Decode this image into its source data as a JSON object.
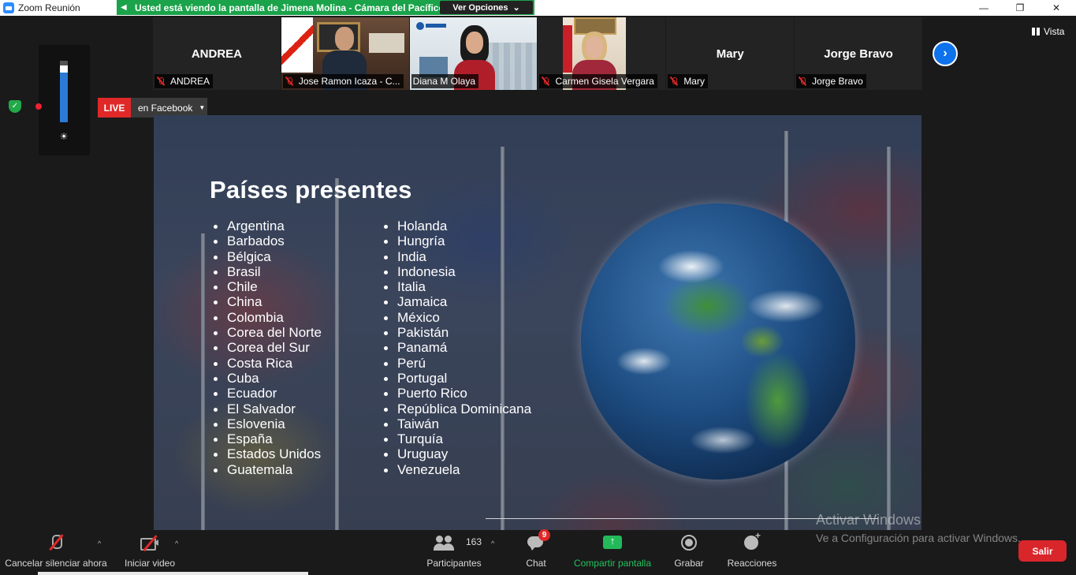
{
  "window": {
    "title": "Zoom Reunión",
    "minimize": "—",
    "restore": "❐",
    "close": "✕"
  },
  "share_banner": {
    "message": "Usted está viendo la pantalla de Jimena Molina - Cámara del Pacífico",
    "options_label": "Ver Opciones",
    "options_caret": "⌄"
  },
  "view": {
    "label": "Vista"
  },
  "participants": [
    {
      "display_name": "ANDREA",
      "tag": "ANDREA",
      "video": false,
      "muted": true
    },
    {
      "display_name": "",
      "tag": "Jose Ramon Icaza - C...",
      "video": true,
      "muted": true
    },
    {
      "display_name": "",
      "tag": "Diana M Olaya",
      "video": true,
      "muted": false,
      "active_speaker": true
    },
    {
      "display_name": "",
      "tag": "Carmen Gisela Vergara",
      "video": true,
      "muted": true
    },
    {
      "display_name": "Mary",
      "tag": "Mary",
      "video": false,
      "muted": true
    },
    {
      "display_name": "Jorge Bravo",
      "tag": "Jorge Bravo",
      "video": false,
      "muted": true
    }
  ],
  "live": {
    "badge": "LIVE",
    "destination": "en Facebook",
    "caret": "▼"
  },
  "slide": {
    "title": "Países presentes",
    "column1": [
      "Argentina",
      "Barbados",
      "Bélgica",
      "Brasil",
      "Chile",
      "China",
      "Colombia",
      "Corea del Norte",
      "Corea del Sur",
      "Costa Rica",
      "Cuba",
      "Ecuador",
      "El Salvador",
      "Eslovenia",
      "España",
      "Estados Unidos",
      "Guatemala"
    ],
    "column2": [
      "Holanda",
      "Hungría",
      "India",
      "Indonesia",
      "Italia",
      "Jamaica",
      "México",
      "Pakistán",
      "Panamá",
      "Perú",
      "Portugal",
      "Puerto Rico",
      "República Dominicana",
      "Taiwán",
      "Turquía",
      "Uruguay",
      "Venezuela"
    ]
  },
  "toolbar": {
    "mute_label": "Cancelar silenciar ahora",
    "video_label": "Iniciar video",
    "participants_label": "Participantes",
    "participants_count": "163",
    "chat_label": "Chat",
    "chat_badge": "9",
    "share_label": "Compartir pantalla",
    "record_label": "Grabar",
    "reactions_label": "Reacciones",
    "leave_label": "Salir",
    "caret": "^"
  },
  "watermark": {
    "line1": "Activar Windows",
    "line2": "Ve a Configuración para activar Windows."
  },
  "colors": {
    "share_green": "#1aa34a",
    "live_red": "#e02828",
    "leave_red": "#d9262b",
    "accent_blue": "#0e72ed"
  }
}
